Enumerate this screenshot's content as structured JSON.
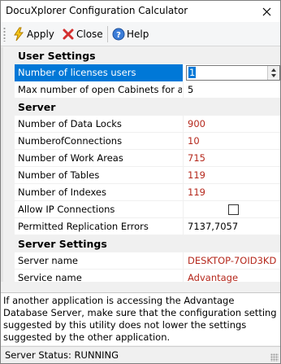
{
  "window": {
    "title": "DocuXplorer Configuration Calculator"
  },
  "toolbar": {
    "apply_label": "Apply",
    "close_label": "Close",
    "help_label": "Help"
  },
  "sections": {
    "user": {
      "title": "User Settings",
      "licenses_label": "Number of licenses users",
      "licenses_value": "1",
      "cabinets_label": "Max number of open Cabinets for a user",
      "cabinets_value": "5"
    },
    "server": {
      "title": "Server",
      "data_locks_label": "Number of Data Locks",
      "data_locks_value": "900",
      "connections_label": "NumberofConnections",
      "connections_value": "10",
      "work_areas_label": "Number of Work Areas",
      "work_areas_value": "715",
      "tables_label": "Number of Tables",
      "tables_value": "119",
      "indexes_label": "Number of Indexes",
      "indexes_value": "119",
      "allow_ip_label": "Allow IP Connections",
      "allow_ip_checked": false,
      "replication_label": "Permitted Replication Errors",
      "replication_value": "7137,7057"
    },
    "server_settings": {
      "title": "Server Settings",
      "server_name_label": "Server name",
      "server_name_value": "DESKTOP-7OID3KD",
      "service_name_label": "Service name",
      "service_name_value": "Advantage"
    }
  },
  "help_text": "If another application is accessing the Advantage Database Server, make sure that the configuration setting suggested by this utility does not lower the settings suggested by the other application.",
  "status": {
    "text": "Server Status: RUNNING"
  },
  "colors": {
    "selection": "#0078d7",
    "modified_value": "#b5281c"
  },
  "icons": [
    "lightning-icon",
    "red-x-icon",
    "help-circle-icon",
    "close-icon"
  ]
}
